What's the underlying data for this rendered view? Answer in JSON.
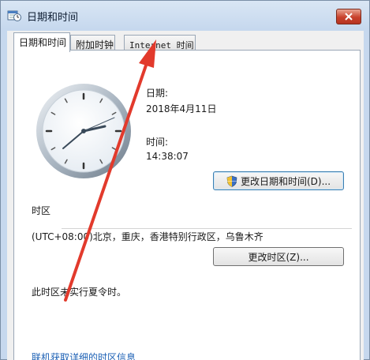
{
  "window": {
    "title": "日期和时间"
  },
  "tabs": [
    {
      "label": "日期和时间",
      "active": true
    },
    {
      "label": "附加时钟",
      "active": false
    },
    {
      "label": "Internet 时间",
      "active": false
    }
  ],
  "date": {
    "label": "日期:",
    "value": "2018年4月11日"
  },
  "time": {
    "label": "时间:",
    "value": "14:38:07"
  },
  "change_datetime_button": {
    "label": "更改日期和时间(D)..."
  },
  "timezone": {
    "section_label": "时区",
    "value": "(UTC+08:00)北京，重庆，香港特别行政区，乌鲁木齐",
    "change_button": "更改时区(Z)...",
    "dst_note": "此时区未实行夏令时。"
  },
  "link": {
    "label": "联机获取详细的时区信息"
  },
  "colors": {
    "accent": "#1a5fb4",
    "annotation_arrow": "#e23a2c",
    "close_button": "#c8412c"
  },
  "icons": {
    "window": "calendar-clock-icon",
    "close": "close-icon",
    "shield": "uac-shield-icon"
  }
}
